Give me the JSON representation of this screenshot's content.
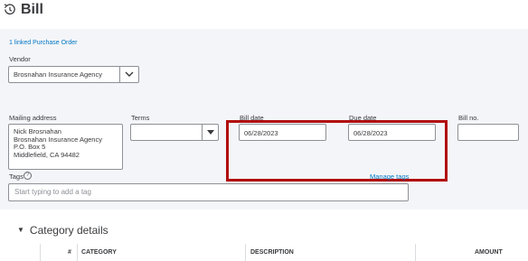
{
  "header": {
    "title": "Bill",
    "icon": "bill-history-icon"
  },
  "form": {
    "linked_po": "1 linked Purchase Order",
    "vendor": {
      "label": "Vendor",
      "value": "Brosnahan Insurance Agency"
    },
    "mailing_address": {
      "label": "Mailing address",
      "lines": [
        "Nick Brosnahan",
        "Brosnahan Insurance Agency",
        "P.O. Box 5",
        "Middlefield, CA  94482"
      ]
    },
    "terms": {
      "label": "Terms",
      "value": ""
    },
    "bill_date": {
      "label": "Bill date",
      "value": "06/28/2023"
    },
    "due_date": {
      "label": "Due date",
      "value": "06/28/2023"
    },
    "bill_no": {
      "label": "Bill no.",
      "value": ""
    },
    "tags": {
      "label": "Tags",
      "help": "?",
      "manage": "Manage tags",
      "placeholder": "Start typing to add a tag"
    }
  },
  "category_details": {
    "title": "Category details",
    "columns": [
      "#",
      "CATEGORY",
      "DESCRIPTION",
      "AMOUNT"
    ]
  },
  "colors": {
    "highlight": "#b10d0d",
    "link": "#0077c5",
    "form_bg": "#f4f5f8"
  }
}
